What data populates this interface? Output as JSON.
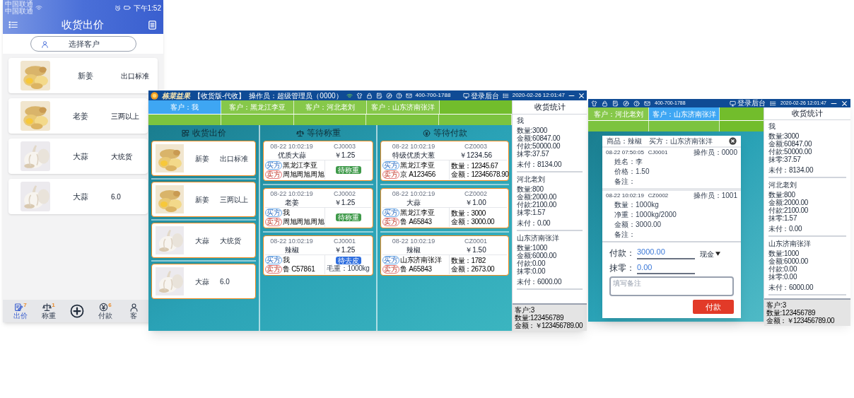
{
  "phone": {
    "status_bar": {
      "carriers": [
        "中国联通",
        "中国联通"
      ],
      "time": "下午1:52"
    },
    "title": "收货出价",
    "customer_button": "选择客户",
    "products": [
      {
        "name": "新姜",
        "spec": "出口标准"
      },
      {
        "name": "老姜",
        "spec": "三两以上"
      },
      {
        "name": "大蒜",
        "spec": "大统货"
      },
      {
        "name": "大蒜",
        "spec": "6.0"
      }
    ],
    "nav": [
      {
        "kind": "offer",
        "label": "出价",
        "badge": "7",
        "selected": true
      },
      {
        "kind": "weigh",
        "label": "称重",
        "badge": "1",
        "selected": false
      },
      {
        "kind": "add"
      },
      {
        "kind": "pay",
        "label": "付款",
        "badge": "6",
        "selected": false
      },
      {
        "kind": "customer",
        "label": "客",
        "selected": false
      }
    ]
  },
  "main_window": {
    "title_bar": {
      "brand": "栋菜益果",
      "edition": "【收货版-代收】",
      "operator": "操作员：超级管理员（0000）",
      "phone": "400-700-1788",
      "admin_link": "登录后台",
      "datetime": "2020-02-26 12:01:47"
    },
    "customer_tabs": [
      {
        "label": "客户：我",
        "selected": true
      },
      {
        "label": "客户：黑龙江李亚",
        "selected": false
      },
      {
        "label": "客户：河北老刘",
        "selected": false
      },
      {
        "label": "客户：山东济南张洋",
        "selected": false
      }
    ],
    "offer_column": {
      "title": "收货出价",
      "items": [
        {
          "name": "新姜",
          "spec": "出口标准"
        },
        {
          "name": "新姜",
          "spec": "三两以上"
        },
        {
          "name": "大蒜",
          "spec": "大统货"
        },
        {
          "name": "大蒜",
          "spec": "6.0"
        }
      ]
    },
    "weighing_column": {
      "title": "等待称重",
      "orders": [
        {
          "time": "08-22 10:02:19",
          "code": "CJ0003",
          "product": "优质大蒜",
          "price": "￥1.25",
          "buyer_tag": "买方",
          "buyer": "黑龙江李亚",
          "seller_tag": "卖方",
          "seller": "周旭周旭周旭",
          "status": {
            "kind": "weigh",
            "label": "待称重"
          }
        },
        {
          "time": "08-22 10:02:19",
          "code": "CJ0002",
          "product": "老姜",
          "price": "￥1.25",
          "buyer_tag": "买方",
          "buyer": "我",
          "seller_tag": "卖方",
          "seller": "周旭周旭周旭",
          "status": {
            "kind": "weigh",
            "label": "待称重"
          }
        },
        {
          "time": "08-22 10:02:19",
          "code": "CJ0001",
          "product": "辣椒",
          "price": "￥1.25",
          "buyer_tag": "买方",
          "buyer": "我",
          "seller_tag": "卖方",
          "seller": "鲁 C57861",
          "status": {
            "kind": "tare",
            "label": "待去皮"
          },
          "gross": "毛重：1000kg"
        }
      ]
    },
    "payment_column": {
      "title": "等待付款",
      "orders": [
        {
          "time": "08-22 10:02:19",
          "code": "CZ0003",
          "product": "特级优质大葱",
          "price": "￥1234.56",
          "buyer_tag": "买方",
          "buyer": "黑龙江李亚",
          "seller_tag": "卖方",
          "seller": "京 A123456",
          "quantity": "数量：12345.67",
          "amount": "金额：12345678.90"
        },
        {
          "time": "08-22 10:02:19",
          "code": "CZ0002",
          "product": "大蒜",
          "price": "￥1.00",
          "buyer_tag": "买方",
          "buyer": "黑龙江李亚",
          "seller_tag": "卖方",
          "seller": "鲁 A65843",
          "quantity": "数量：3000",
          "amount": "金额：3000.00"
        },
        {
          "time": "08-22 10:02:19",
          "code": "CZ0001",
          "product": "辣椒",
          "price": "￥1.50",
          "buyer_tag": "买方",
          "buyer": "山东济南张洋",
          "seller_tag": "卖方",
          "seller": "鲁 A65843",
          "quantity": "数量：1782",
          "amount": "金额：2673.00"
        }
      ]
    },
    "stats": {
      "title": "收货统计",
      "groups": [
        {
          "name": "我",
          "lines": [
            "数量:3000",
            "金额:60847.00",
            "付款:50000.00",
            "抹零:37.57"
          ],
          "unpaid": "未付：8134.00"
        },
        {
          "name": "河北老刘",
          "lines": [
            "数量:800",
            "金额:2000.00",
            "付款:2100.00",
            "抹零:1.57"
          ],
          "unpaid": "未付：0.00"
        },
        {
          "name": "山东济南张洋",
          "lines": [
            "数量:1000",
            "金额:6000.00",
            "付款:0.00",
            "抹零:0.00"
          ],
          "unpaid": "未付：6000.00"
        }
      ],
      "customer_count": "客户:3",
      "quantity_total": "数量:123456789",
      "amount_total": "金额：￥123456789.00"
    }
  },
  "payment_window": {
    "title_bar": {
      "phone": "400-700-1788",
      "admin_link": "登录后台",
      "datetime": "2020-02-26 12:01:47"
    },
    "customer_tabs": [
      {
        "label": "客户：河北老刘",
        "selected": false
      },
      {
        "label": "客户：山东济南张洋",
        "selected": true
      }
    ],
    "dialog": {
      "product": "商品：辣椒",
      "buyer": "买方：山东济南张洋",
      "records": [
        {
          "time": "08-22 07:50:05",
          "code": "CJ0001",
          "operator": "操作员：0000",
          "fields": [
            "姓名：李",
            "价格：1.50",
            "备注："
          ]
        },
        {
          "time": "08-22 10:02:19",
          "code": "CZ0002",
          "operator": "操作员：1001",
          "fields": [
            "数量：1000kg",
            "净重：1000kg/2000",
            "金额：3000.00",
            "备注："
          ]
        }
      ],
      "payment_label": "付款：",
      "payment_value": "3000.00",
      "method": "现金",
      "rounding_label": "抹零：",
      "rounding_value": "0.00",
      "notes_placeholder": "填写备注",
      "pay_button": "付款"
    },
    "stats": {
      "title": "收货统计",
      "groups": [
        {
          "name": "我",
          "lines": [
            "数量:3000",
            "金额:60847.00",
            "付款:50000.00",
            "抹零:37.57"
          ],
          "unpaid": "未付：8134.00"
        },
        {
          "name": "河北老刘",
          "lines": [
            "数量:800",
            "金额:2000.00",
            "付款:2100.00",
            "抹零:1.57"
          ],
          "unpaid": "未付：0.00"
        },
        {
          "name": "山东济南张洋",
          "lines": [
            "数量:1000",
            "金额:6000.00",
            "付款:0.00",
            "抹零:0.00"
          ],
          "unpaid": "未付：6000.00"
        }
      ],
      "customer_count": "客户:3",
      "quantity_total": "数量:123456789",
      "amount_total": "金额：￥123456789.00"
    }
  }
}
